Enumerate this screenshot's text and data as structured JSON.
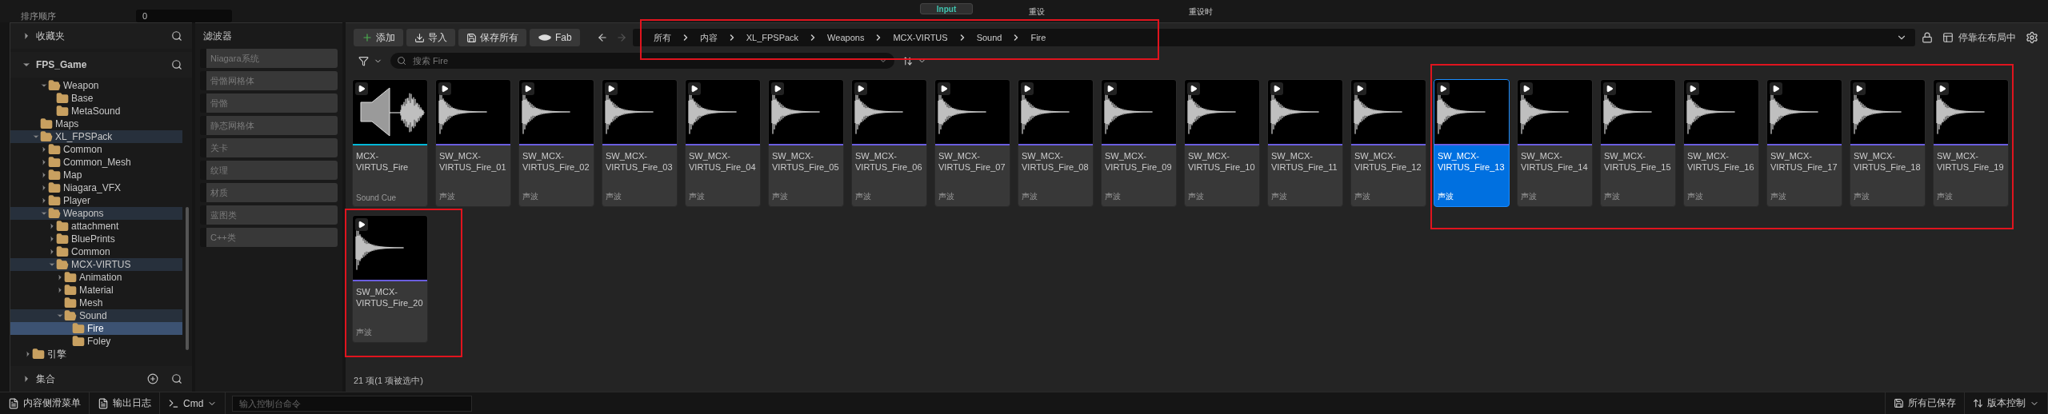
{
  "background_editor": {
    "property_label": "排序顺序",
    "property_value": "0",
    "tab": "Input",
    "reset_label": "重设",
    "reset_on_label": "重设时"
  },
  "sources": {
    "favorites": {
      "label": "收藏夹",
      "expanded": false
    },
    "project": {
      "label": "FPS_Game",
      "expanded": true
    },
    "tree": [
      {
        "children": [
          {
            "children": [
              {
                "label": "Weapon",
                "expanded": true,
                "selected": false,
                "on_path": false,
                "children": [
                  {
                    "label": "Base",
                    "selected": false,
                    "on_path": false
                  },
                  {
                    "label": "MetaSound",
                    "selected": false,
                    "on_path": false
                  }
                ]
              }
            ]
          },
          {
            "label": "Maps",
            "selected": false,
            "on_path": false
          },
          {
            "label": "XL_FPSPack",
            "expanded": true,
            "selected": false,
            "on_path": true,
            "children": [
              {
                "label": "Common",
                "expanded": false,
                "selected": false,
                "on_path": false
              },
              {
                "label": "Common_Mesh",
                "expanded": false,
                "selected": false,
                "on_path": false
              },
              {
                "label": "Map",
                "expanded": false,
                "selected": false,
                "on_path": false
              },
              {
                "label": "Niagara_VFX",
                "expanded": false,
                "selected": false,
                "on_path": false
              },
              {
                "label": "Player",
                "expanded": false,
                "selected": false,
                "on_path": false
              },
              {
                "label": "Weapons",
                "expanded": true,
                "selected": false,
                "on_path": true,
                "children": [
                  {
                    "label": "attachment",
                    "expanded": false,
                    "selected": false,
                    "on_path": false
                  },
                  {
                    "label": "BluePrints",
                    "expanded": false,
                    "selected": false,
                    "on_path": false
                  },
                  {
                    "label": "Common",
                    "expanded": false,
                    "selected": false,
                    "on_path": false
                  },
                  {
                    "label": "MCX-VIRTUS",
                    "expanded": true,
                    "selected": false,
                    "on_path": true,
                    "children": [
                      {
                        "label": "Animation",
                        "expanded": false,
                        "selected": false,
                        "on_path": false
                      },
                      {
                        "label": "Material",
                        "expanded": false,
                        "selected": false,
                        "on_path": false
                      },
                      {
                        "label": "Mesh",
                        "selected": false,
                        "on_path": false
                      },
                      {
                        "label": "Sound",
                        "expanded": true,
                        "selected": false,
                        "on_path": true,
                        "children": [
                          {
                            "label": "Fire",
                            "selected": true,
                            "on_path": false
                          },
                          {
                            "label": "Foley",
                            "selected": false,
                            "on_path": false
                          }
                        ]
                      }
                    ]
                  }
                ]
              }
            ]
          }
        ]
      },
      {
        "label": "引擎",
        "expanded": false,
        "selected": false,
        "on_path": false
      }
    ],
    "collections": {
      "label": "集合",
      "expanded": false
    }
  },
  "filters": {
    "title": "滤波器",
    "items": [
      "Niagara系统",
      "骨骼网格体",
      "骨骼",
      "静态网格体",
      "关卡",
      "纹理",
      "材质",
      "蓝图类",
      "C++类"
    ]
  },
  "toolbar": {
    "buttons": [
      {
        "kind": "add",
        "label": "添加"
      },
      {
        "kind": "import",
        "label": "导入"
      },
      {
        "kind": "save",
        "label": "保存所有"
      },
      {
        "kind": "fab",
        "label": "Fab"
      }
    ],
    "back_disabled": false,
    "forward_disabled": true,
    "breadcrumb": [
      "所有",
      "内容",
      "XL_FPSPack",
      "Weapons",
      "MCX-VIRTUS",
      "Sound",
      "Fire"
    ],
    "dock_label": "停靠在布局中"
  },
  "search": {
    "placeholder": "搜索 Fire"
  },
  "assets": [
    {
      "name": "MCX-VIRTUS_Fire",
      "type": "Sound Cue",
      "kind": "sound_cue",
      "selected": false
    },
    {
      "name": "SW_MCX-VIRTUS_Fire_01",
      "type": "声波",
      "kind": "sound_wave",
      "selected": false
    },
    {
      "name": "SW_MCX-VIRTUS_Fire_02",
      "type": "声波",
      "kind": "sound_wave",
      "selected": false
    },
    {
      "name": "SW_MCX-VIRTUS_Fire_03",
      "type": "声波",
      "kind": "sound_wave",
      "selected": false
    },
    {
      "name": "SW_MCX-VIRTUS_Fire_04",
      "type": "声波",
      "kind": "sound_wave",
      "selected": false
    },
    {
      "name": "SW_MCX-VIRTUS_Fire_05",
      "type": "声波",
      "kind": "sound_wave",
      "selected": false
    },
    {
      "name": "SW_MCX-VIRTUS_Fire_06",
      "type": "声波",
      "kind": "sound_wave",
      "selected": false
    },
    {
      "name": "SW_MCX-VIRTUS_Fire_07",
      "type": "声波",
      "kind": "sound_wave",
      "selected": false
    },
    {
      "name": "SW_MCX-VIRTUS_Fire_08",
      "type": "声波",
      "kind": "sound_wave",
      "selected": false
    },
    {
      "name": "SW_MCX-VIRTUS_Fire_09",
      "type": "声波",
      "kind": "sound_wave",
      "selected": false
    },
    {
      "name": "SW_MCX-VIRTUS_Fire_10",
      "type": "声波",
      "kind": "sound_wave",
      "selected": false
    },
    {
      "name": "SW_MCX-VIRTUS_Fire_11",
      "type": "声波",
      "kind": "sound_wave",
      "selected": false
    },
    {
      "name": "SW_MCX-VIRTUS_Fire_12",
      "type": "声波",
      "kind": "sound_wave",
      "selected": false
    },
    {
      "name": "SW_MCX-VIRTUS_Fire_13",
      "type": "声波",
      "kind": "sound_wave",
      "selected": true
    },
    {
      "name": "SW_MCX-VIRTUS_Fire_14",
      "type": "声波",
      "kind": "sound_wave",
      "selected": false
    },
    {
      "name": "SW_MCX-VIRTUS_Fire_15",
      "type": "声波",
      "kind": "sound_wave",
      "selected": false
    },
    {
      "name": "SW_MCX-VIRTUS_Fire_16",
      "type": "声波",
      "kind": "sound_wave",
      "selected": false
    },
    {
      "name": "SW_MCX-VIRTUS_Fire_17",
      "type": "声波",
      "kind": "sound_wave",
      "selected": false
    },
    {
      "name": "SW_MCX-VIRTUS_Fire_18",
      "type": "声波",
      "kind": "sound_wave",
      "selected": false
    },
    {
      "name": "SW_MCX-VIRTUS_Fire_19",
      "type": "声波",
      "kind": "sound_wave",
      "selected": false
    },
    {
      "name": "SW_MCX-VIRTUS_Fire_20",
      "type": "声波",
      "kind": "sound_wave",
      "selected": false
    }
  ],
  "item_count": "21 项(1 项被选中)",
  "status_bar": {
    "drawer": "内容侧滑菜单",
    "output_log": "输出日志",
    "cmd": "Cmd",
    "console_placeholder": "输入控制台命令",
    "save_state": "所有已保存",
    "source_control": "版本控制"
  }
}
